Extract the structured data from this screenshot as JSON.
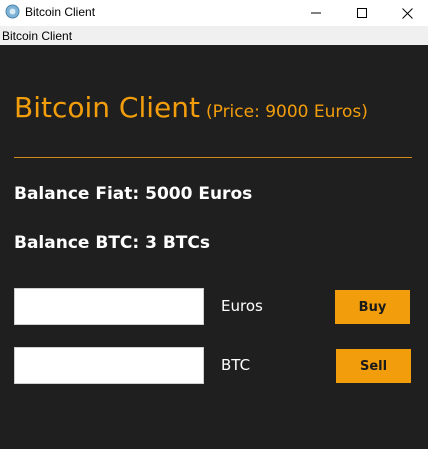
{
  "window": {
    "title": "Bitcoin Client",
    "app_icon": "bitcoin-client-app-icon"
  },
  "menu": {
    "label": "Bitcoin Client"
  },
  "header": {
    "title": "Bitcoin Client",
    "price": "(Price: 9000 Euros)"
  },
  "balances": {
    "fiat": "Balance Fiat: 5000 Euros",
    "btc": "Balance BTC: 3 BTCs"
  },
  "trade": {
    "euros_value": "",
    "euros_unit": "Euros",
    "buy_label": "Buy",
    "btc_value": "",
    "btc_unit": "BTC",
    "sell_label": "Sell"
  },
  "colors": {
    "accent": "#f29e0c",
    "panel_bg": "#1f1f1f",
    "text": "#ffffff"
  }
}
